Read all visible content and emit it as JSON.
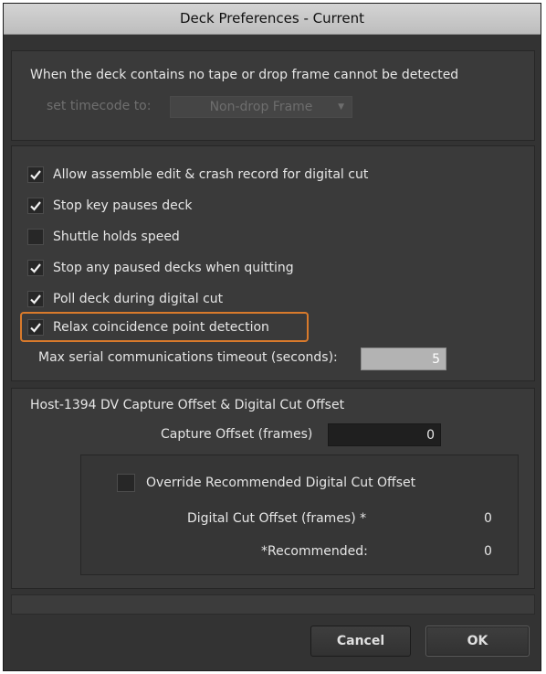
{
  "window": {
    "title": "Deck Preferences - Current"
  },
  "no_tape": {
    "heading": "When the deck contains no tape or drop frame cannot be detected",
    "set_label": "set timecode to:",
    "select_value": "Non-drop Frame"
  },
  "options": [
    {
      "label": "Allow assemble edit & crash record for digital cut",
      "checked": true
    },
    {
      "label": "Stop key pauses deck",
      "checked": true
    },
    {
      "label": "Shuttle holds speed",
      "checked": false
    },
    {
      "label": "Stop any paused decks when quitting",
      "checked": true
    },
    {
      "label": "Poll deck during digital cut",
      "checked": true
    },
    {
      "label": "Relax coincidence point detection",
      "checked": true
    }
  ],
  "serial": {
    "label": "Max serial communications timeout (seconds):",
    "value": "5"
  },
  "offsets": {
    "heading": "Host-1394 DV Capture Offset & Digital Cut Offset",
    "capture_label": "Capture Offset (frames)",
    "capture_value": "0",
    "override_label": "Override Recommended Digital Cut Offset",
    "override_checked": false,
    "digital_cut_label": "Digital Cut Offset (frames) *",
    "digital_cut_value": "0",
    "recommended_label": "*Recommended:",
    "recommended_value": "0"
  },
  "buttons": {
    "cancel": "Cancel",
    "ok": "OK"
  },
  "colors": {
    "highlight": "#d97a2b",
    "background": "#333333"
  }
}
